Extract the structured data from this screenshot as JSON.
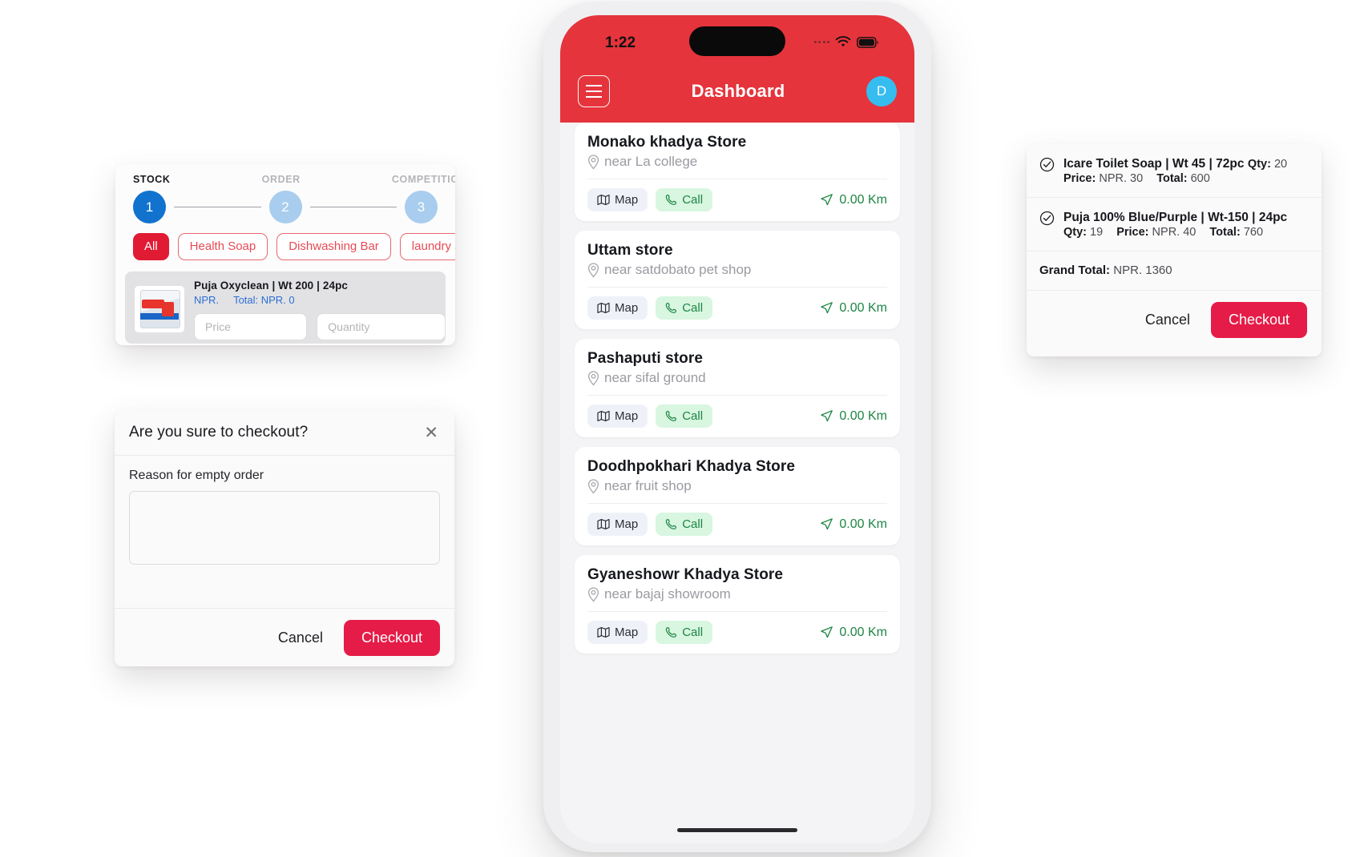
{
  "stock_card": {
    "steps": [
      {
        "label": "STOCK",
        "number": "1",
        "active": true
      },
      {
        "label": "ORDER",
        "number": "2",
        "active": false
      },
      {
        "label": "COMPETITIC",
        "number": "3",
        "active": false
      }
    ],
    "filters": [
      {
        "label": "All",
        "selected": true
      },
      {
        "label": "Health Soap",
        "selected": false
      },
      {
        "label": "Dishwashing Bar",
        "selected": false
      },
      {
        "label": "laundry soap",
        "selected": false
      }
    ],
    "product": {
      "title": "Puja Oxyclean | Wt 200 | 24pc",
      "currency": "NPR.",
      "total": "Total: NPR. 0",
      "price_placeholder": "Price",
      "quantity_placeholder": "Quantity",
      "price_value": "",
      "quantity_value": ""
    }
  },
  "confirm_dialog": {
    "title": "Are you sure to checkout?",
    "close_icon": "close-icon",
    "reason_label": "Reason for empty order",
    "reason_value": "",
    "cancel_label": "Cancel",
    "checkout_label": "Checkout"
  },
  "phone": {
    "status": {
      "time": "1:22",
      "wifi_icon": "wifi-icon",
      "battery_icon": "battery-icon"
    },
    "header": {
      "menu_icon": "hamburger-menu-icon",
      "title": "Dashboard",
      "avatar_initial": "D",
      "background_color": "#e5343c"
    },
    "stores": [
      {
        "name": "Monako khadya Store",
        "near": "near La college",
        "map_label": "Map",
        "call_label": "Call",
        "distance": "0.00 Km"
      },
      {
        "name": "Uttam store",
        "near": "near satdobato pet shop",
        "map_label": "Map",
        "call_label": "Call",
        "distance": "0.00 Km"
      },
      {
        "name": "Pashaputi store",
        "near": "near sifal ground",
        "map_label": "Map",
        "call_label": "Call",
        "distance": "0.00 Km"
      },
      {
        "name": "Doodhpokhari Khadya Store",
        "near": "near fruit shop",
        "map_label": "Map",
        "call_label": "Call",
        "distance": "0.00 Km"
      },
      {
        "name": "Gyaneshowr Khadya Store",
        "near": "near bajaj showroom",
        "map_label": "Map",
        "call_label": "Call",
        "distance": "0.00 Km"
      }
    ]
  },
  "summary": {
    "items": [
      {
        "name": "Icare Toilet Soap | Wt 45 | 72pc",
        "qty_label": "Qty:",
        "qty_value": "20",
        "price_label": "Price:",
        "price_value": "NPR. 30",
        "total_label": "Total:",
        "total_value": "600"
      },
      {
        "name": "Puja 100% Blue/Purple | Wt-150 | 24pc",
        "qty_label": "Qty:",
        "qty_value": "19",
        "price_label": "Price:",
        "price_value": "NPR. 40",
        "total_label": "Total:",
        "total_value": "760"
      }
    ],
    "grand_total_label": "Grand Total:",
    "grand_total_value": "NPR. 1360",
    "cancel_label": "Cancel",
    "checkout_label": "Checkout"
  },
  "colors": {
    "brand_red": "#e5343c",
    "accent_pink": "#e51c47",
    "step_active_blue": "#1273cf",
    "step_inactive_blue": "#a8cdee",
    "green": "#1d8544",
    "avatar_blue": "#35bdf0"
  }
}
